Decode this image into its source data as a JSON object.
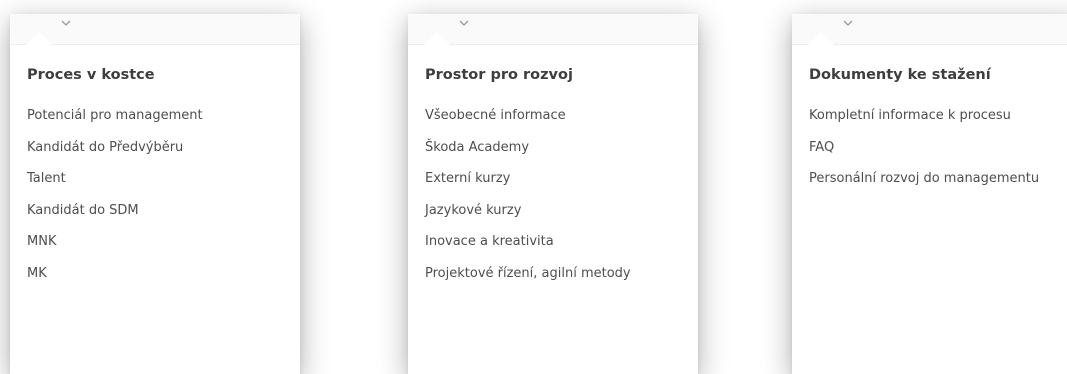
{
  "panels": [
    {
      "title": "Proces v kostce",
      "items": [
        "Potenciál pro management",
        "Kandidát do Předvýběru",
        "Talent",
        "Kandidát do SDM",
        "MNK",
        "MK"
      ]
    },
    {
      "title": "Prostor pro rozvoj",
      "items": [
        "Všeobecné informace",
        "Škoda Academy",
        "Externí kurzy",
        "Jazykové kurzy",
        "Inovace a kreativita",
        "Projektové řízení, agilní metody"
      ]
    },
    {
      "title": "Dokumenty ke stažení",
      "items": [
        "Kompletní informace k procesu",
        "FAQ",
        "Personální rozvoj do managementu"
      ]
    }
  ],
  "icons": {
    "chevron": "chevron-down-icon"
  },
  "colors": {
    "panel_bg": "#ffffff",
    "title_text": "#3e3e3e",
    "link_text": "#4e4e4e"
  }
}
